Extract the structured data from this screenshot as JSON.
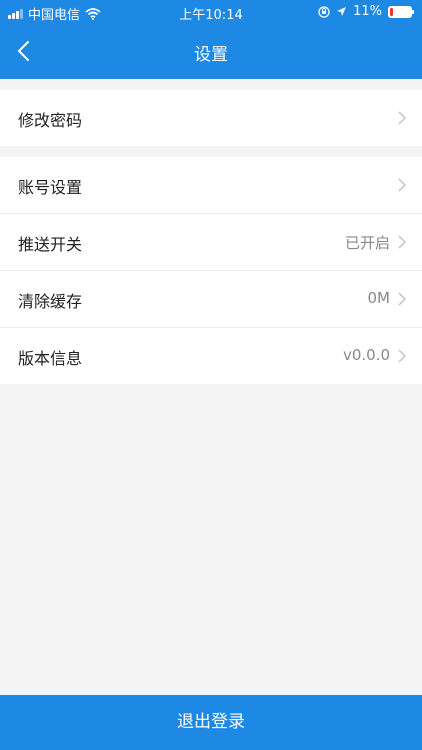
{
  "status_bar": {
    "carrier": "中国电信",
    "time": "上午10:14",
    "battery": "11%"
  },
  "header": {
    "title": "设置"
  },
  "sections": [
    {
      "items": [
        {
          "label": "修改密码",
          "value": ""
        }
      ]
    },
    {
      "items": [
        {
          "label": "账号设置",
          "value": ""
        },
        {
          "label": "推送开关",
          "value": "已开启"
        },
        {
          "label": "清除缓存",
          "value": "0M"
        },
        {
          "label": "版本信息",
          "value": "v0.0.0"
        }
      ]
    }
  ],
  "footer": {
    "logout_label": "退出登录"
  },
  "colors": {
    "primary": "#1e88e5",
    "background": "#f4f4f4",
    "battery_low": "#e53935"
  }
}
